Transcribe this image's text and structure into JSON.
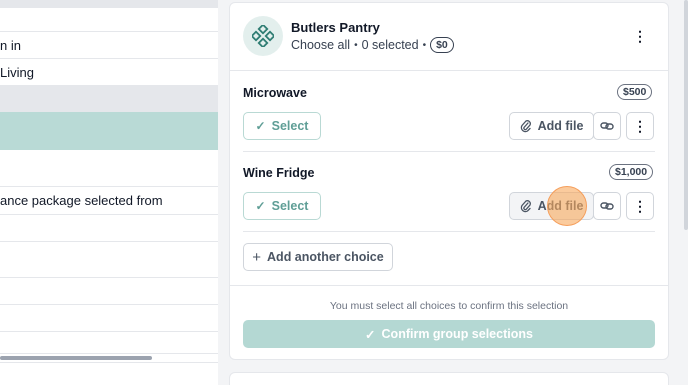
{
  "left_table": {
    "rows": [
      {
        "text": "",
        "style": "gray"
      },
      {
        "text": "",
        "style": "white"
      },
      {
        "text": "n in",
        "style": "white"
      },
      {
        "text": "Living",
        "style": "white"
      },
      {
        "text": "",
        "style": "gray"
      },
      {
        "text": "",
        "style": "teal"
      },
      {
        "text": "",
        "style": "white"
      },
      {
        "text": "ance package selected from",
        "style": "white"
      },
      {
        "text": "",
        "style": "white"
      },
      {
        "text": "",
        "style": "white"
      },
      {
        "text": "",
        "style": "white"
      },
      {
        "text": "",
        "style": "white"
      },
      {
        "text": "",
        "style": "white"
      }
    ]
  },
  "group": {
    "icon": "diamond-grid-icon",
    "title": "Butlers Pantry",
    "choose_all": "Choose all",
    "separator": "•",
    "selected_count": "0 selected",
    "total": "$0"
  },
  "choices": [
    {
      "name": "Microwave",
      "price": "$500"
    },
    {
      "name": "Wine Fridge",
      "price": "$1,000"
    }
  ],
  "labels": {
    "select": "Select",
    "add_file": "Add file",
    "add_another_choice": "Add another choice",
    "notice": "You must select all choices to confirm this selection",
    "confirm": "Confirm group selections",
    "more": "⋮"
  },
  "colors": {
    "accent": "#5f9e96",
    "confirm_disabled": "#b4d8d3",
    "selected_row": "#b9dad6",
    "cursor": "#f59e5b"
  }
}
